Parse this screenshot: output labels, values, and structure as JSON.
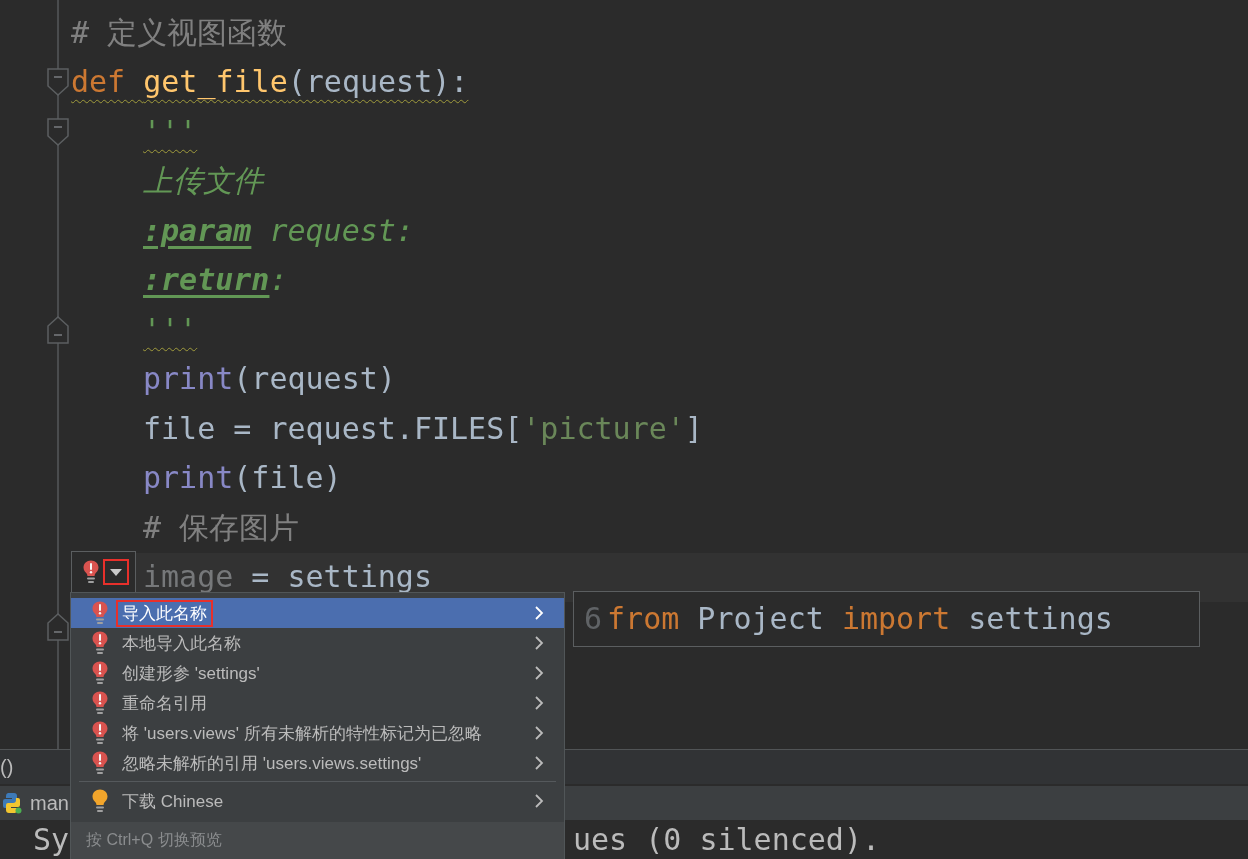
{
  "editor": {
    "lines": [
      {
        "warning": false,
        "current": false,
        "tokens": [
          {
            "text": "# 定义视图函数",
            "kind": "comment"
          }
        ]
      },
      {
        "fold_marker": {
          "kind": "start"
        },
        "warning": true,
        "current": false,
        "tokens": [
          {
            "text": "def ",
            "kind": "keyword"
          },
          {
            "text": "get_file",
            "kind": "function"
          },
          {
            "text": "(request):",
            "kind": "plain"
          }
        ],
        "children": [
          {
            "fold_marker": {
              "kind": "start"
            },
            "warning": true,
            "current": false,
            "tokens": [
              {
                "text": "'''",
                "kind": "docstring"
              }
            ]
          },
          {
            "warning": false,
            "current": false,
            "tokens": [
              {
                "text": "上传文件",
                "kind": "docstring"
              }
            ]
          },
          {
            "warning": false,
            "current": false,
            "tokens": [
              {
                "text": ":param",
                "kind": "doc_tag"
              },
              {
                "text": " request:",
                "kind": "docstring"
              }
            ]
          },
          {
            "warning": false,
            "current": false,
            "tokens": [
              {
                "text": ":return",
                "kind": "doc_tag"
              },
              {
                "text": ":",
                "kind": "docstring"
              }
            ]
          },
          {
            "fold_marker": {
              "kind": "end"
            },
            "warning": true,
            "current": false,
            "tokens": [
              {
                "text": "'''",
                "kind": "docstring"
              }
            ]
          },
          {
            "warning": false,
            "current": false,
            "tokens": [
              {
                "text": "print",
                "kind": "builtin"
              },
              {
                "text": "(request)",
                "kind": "plain"
              }
            ]
          },
          {
            "warning": false,
            "current": false,
            "tokens": [
              {
                "text": "file = request.FILES[",
                "kind": "plain"
              },
              {
                "text": "'picture'",
                "kind": "string"
              },
              {
                "text": "]",
                "kind": "plain"
              }
            ]
          },
          {
            "warning": false,
            "current": false,
            "tokens": [
              {
                "text": "print",
                "kind": "builtin"
              },
              {
                "text": "(file)",
                "kind": "plain"
              }
            ]
          },
          {
            "warning": false,
            "current": false,
            "tokens": [
              {
                "text": "# 保存图片",
                "kind": "comment"
              }
            ]
          },
          {
            "warning": false,
            "current": true,
            "tokens": [
              {
                "text": "image",
                "kind": "unused"
              },
              {
                "text": " = settings",
                "kind": "plain"
              }
            ]
          }
        ]
      },
      {
        "fold_marker": {
          "kind": "end"
        }
      }
    ],
    "intention_button": {
      "annotated": true
    }
  },
  "quick_fixes": {
    "groups": [
      {
        "items": [
          {
            "kind": "error",
            "label": "导入此名称",
            "selected": true,
            "annotated": true
          },
          {
            "kind": "error",
            "label": "本地导入此名称",
            "selected": false,
            "annotated": false
          },
          {
            "kind": "error",
            "label": "创建形参 'settings'",
            "selected": false,
            "annotated": false
          },
          {
            "kind": "error",
            "label": "重命名引用",
            "selected": false,
            "annotated": false
          },
          {
            "kind": "error",
            "label": "将 'users.views' 所有未解析的特性标记为已忽略",
            "selected": false,
            "annotated": false
          },
          {
            "kind": "error",
            "label": "忽略未解析的引用 'users.views.settings'",
            "selected": false,
            "annotated": false
          }
        ]
      },
      {
        "items": [
          {
            "kind": "suggestion",
            "label": "下载 Chinese",
            "selected": false,
            "annotated": false
          }
        ]
      }
    ],
    "hint": "按 Ctrl+Q 切换预览"
  },
  "preview": {
    "line_number": "6",
    "tokens": [
      {
        "text": "from",
        "kind": "keyword"
      },
      {
        "text": " Project ",
        "kind": "plain"
      },
      {
        "text": "import",
        "kind": "keyword"
      },
      {
        "text": " settings",
        "kind": "plain"
      }
    ]
  },
  "tool_window": {
    "title": "()"
  },
  "editor_tabs": [
    {
      "label": "man"
    }
  ],
  "console": {
    "fragments": [
      {
        "text": "Sy"
      },
      {
        "text": "ues (0 silenced)."
      }
    ]
  }
}
